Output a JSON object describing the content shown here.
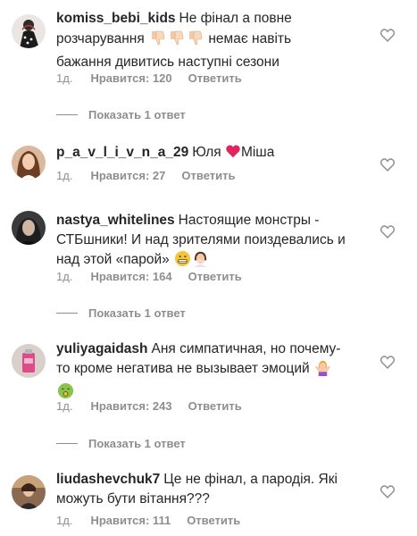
{
  "comments": [
    {
      "username": "komiss_bebi_kids",
      "text_line1": "Не фінал а повне",
      "text_line2": "розчарування",
      "text_line2_after": "немає навіть",
      "text_line3": "бажання дивитись наступні сезони",
      "age": "1д.",
      "likes": "Нравится: 120",
      "reply": "Ответить",
      "replies": "Показать 1 ответ",
      "emoji": [
        "thumbs-down-icon",
        "thumbs-down-icon",
        "thumbs-down-icon"
      ]
    },
    {
      "username": "p_a_v_l_i_v_n_a_29",
      "text_before": "Юля",
      "text_after": "Міша",
      "age": "1д.",
      "likes": "Нравится: 27",
      "reply": "Ответить",
      "emoji": [
        "red-heart-icon"
      ]
    },
    {
      "username": "nastya_whitelines",
      "text_line1": "Настоящие монстры -",
      "text_line2": "СТБшники! И над зрителями поиздевались и",
      "text_line3": "над этой «парой»",
      "age": "1д.",
      "likes": "Нравится: 164",
      "reply": "Ответить",
      "replies": "Показать 1 ответ",
      "emoji": [
        "grimacing-face-icon",
        "woman-facepalming-icon"
      ]
    },
    {
      "username": "yuliyagaidash",
      "text_line1": "Аня симпатичная, но почему-",
      "text_line2": "то кроме негатива не вызывает эмоций",
      "age": "1д.",
      "likes": "Нравится: 243",
      "reply": "Ответить",
      "replies": "Показать 1 ответ",
      "emoji": [
        "woman-shrugging-icon",
        "nauseated-face-icon"
      ]
    },
    {
      "username": "liudashevchuk7",
      "text_line1": "Це не фінал, а пародія. Які",
      "text_line2": "можуть бути вітання???",
      "age": "1д.",
      "likes": "Нравится: 111",
      "reply": "Ответить"
    }
  ],
  "colors": {
    "text": "#262626",
    "secondary": "#8e8e8e",
    "heart_red": "#e0245e"
  }
}
